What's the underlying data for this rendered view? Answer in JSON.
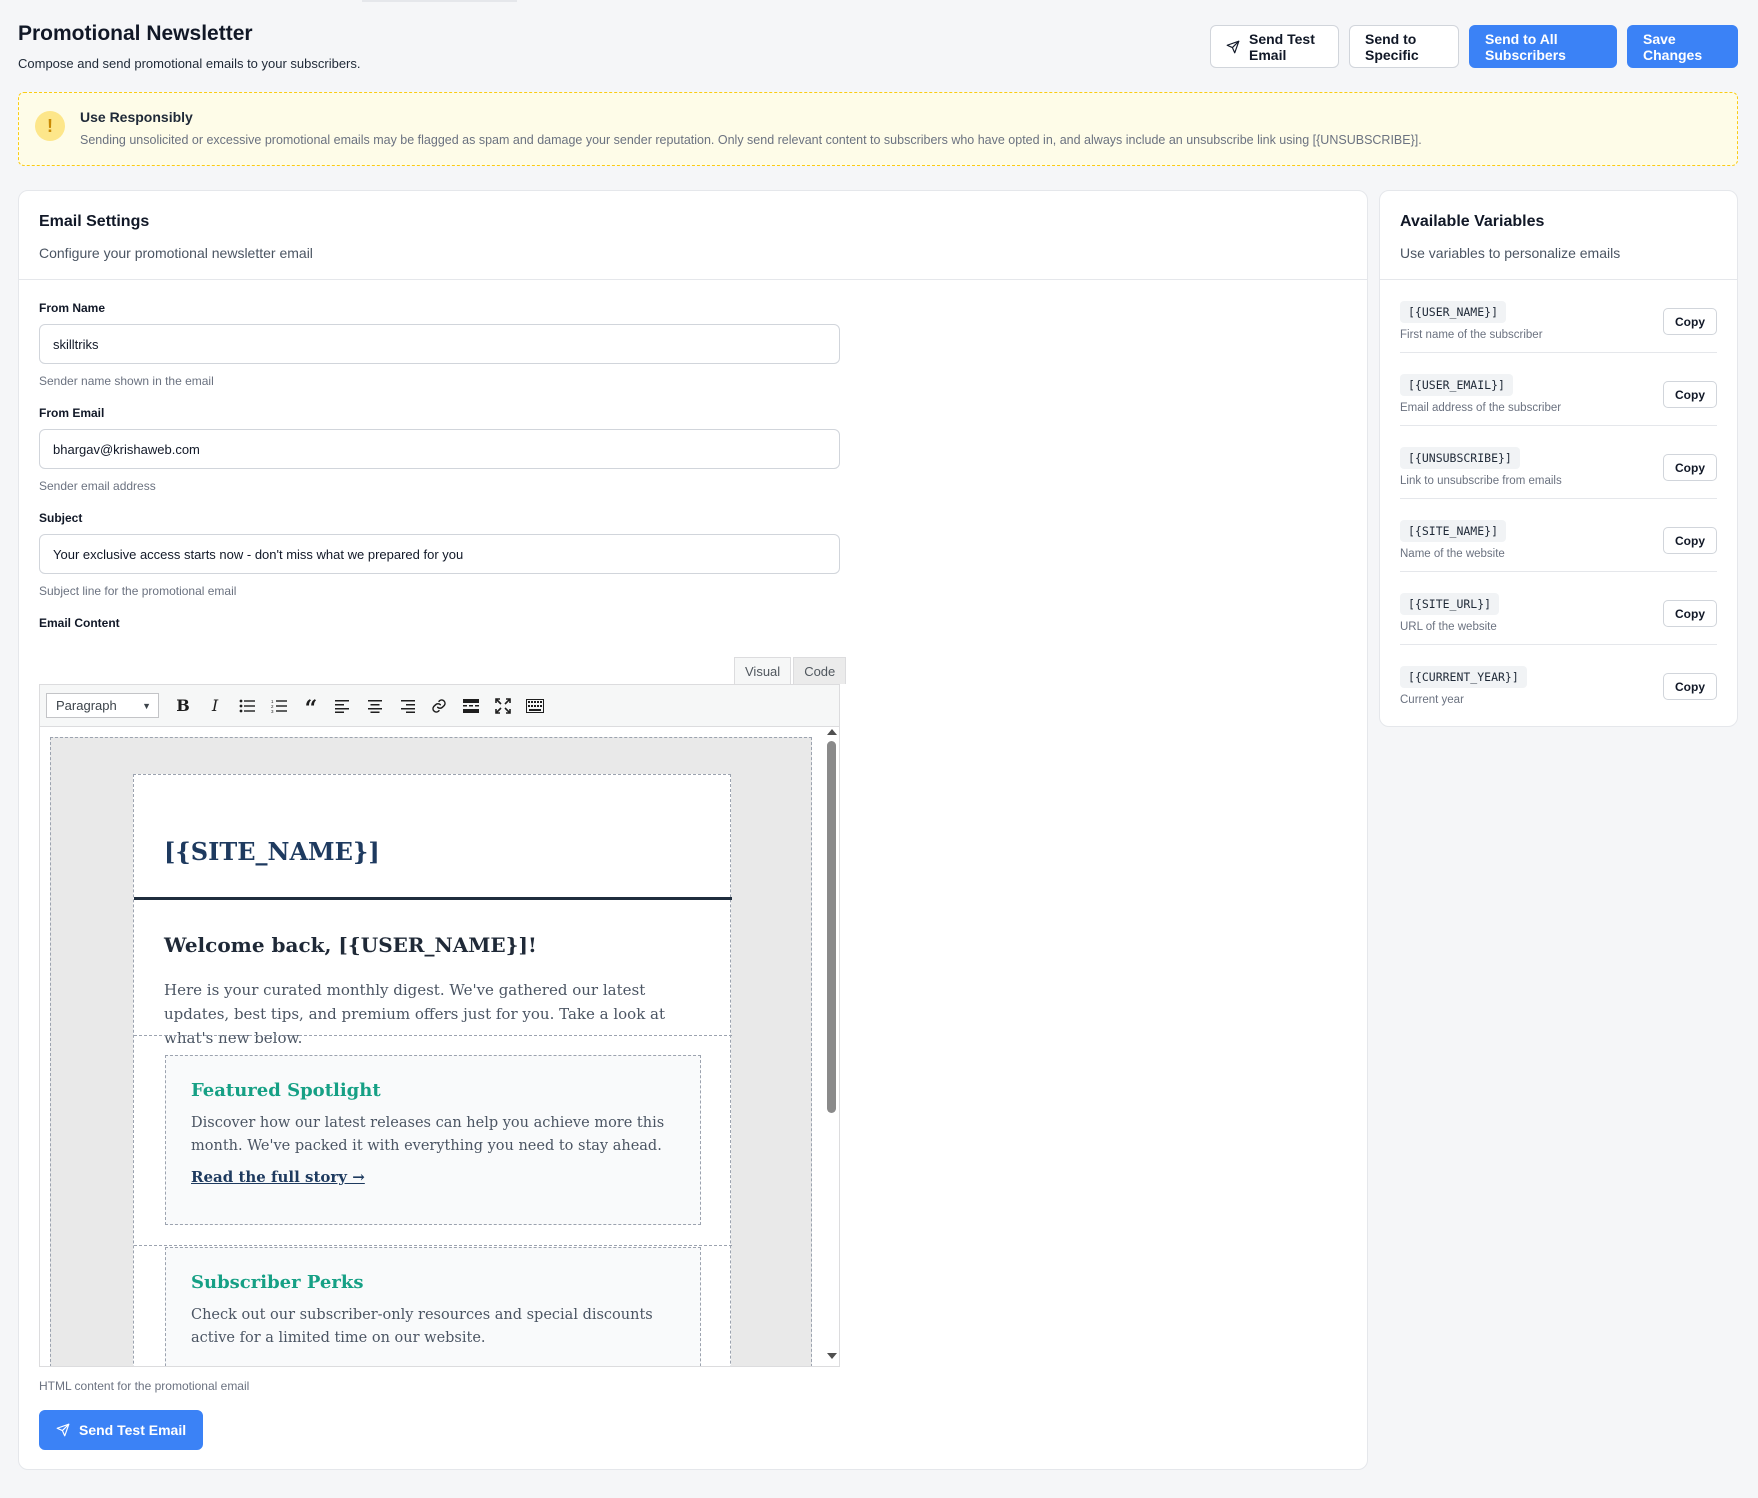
{
  "header": {
    "title": "Promotional Newsletter",
    "subtitle": "Compose and send promotional emails to your subscribers.",
    "buttons": {
      "send_test": "Send Test Email",
      "send_specific": "Send to Specific",
      "send_all": "Send to All Subscribers",
      "save": "Save Changes"
    }
  },
  "alert": {
    "icon": "warning-icon",
    "title": "Use Responsibly",
    "text": "Sending unsolicited or excessive promotional emails may be flagged as spam and damage your sender reputation. Only send relevant content to subscribers who have opted in, and always include an unsubscribe link using [{UNSUBSCRIBE}]."
  },
  "settings": {
    "title": "Email Settings",
    "description": "Configure your promotional newsletter email",
    "from_name": {
      "label": "From Name",
      "value": "skilltriks",
      "help": "Sender name shown in the email"
    },
    "from_email": {
      "label": "From Email",
      "value": "bhargav@krishaweb.com",
      "help": "Sender email address"
    },
    "subject": {
      "label": "Subject",
      "value": "Your exclusive access starts now - don't miss what we prepared for you",
      "help": "Subject line for the promotional email"
    },
    "content": {
      "label": "Email Content",
      "tabs": [
        "Visual",
        "Code"
      ],
      "active_tab": "Visual",
      "format": "Paragraph",
      "toolbar": [
        "bold-icon",
        "italic-icon",
        "bullet-list-icon",
        "numbered-list-icon",
        "blockquote-icon",
        "align-left-icon",
        "align-center-icon",
        "align-right-icon",
        "link-icon",
        "read-more-icon",
        "fullscreen-icon",
        "toolbar-toggle-icon"
      ],
      "help": "HTML content for the promotional email"
    },
    "send_test_label": "Send Test Email"
  },
  "email_preview": {
    "site_name": "[{SITE_NAME}]",
    "welcome": "Welcome back, [{USER_NAME}]!",
    "intro": "Here is your curated monthly digest. We've gathered our latest updates, best tips, and premium offers just for you. Take a look at what's new below.",
    "featured_title": "Featured Spotlight",
    "featured_text": "Discover how our latest releases can help you achieve more this month. We've packed it with everything you need to stay ahead.",
    "featured_link": "Read the full story →",
    "perks_title": "Subscriber Perks",
    "perks_text": "Check out our subscriber-only resources and special discounts active for a limited time on our website."
  },
  "variables": {
    "title": "Available Variables",
    "description": "Use variables to personalize emails",
    "copy_label": "Copy",
    "items": [
      {
        "code": "[{USER_NAME}]",
        "desc": "First name of the subscriber"
      },
      {
        "code": "[{USER_EMAIL}]",
        "desc": "Email address of the subscriber"
      },
      {
        "code": "[{UNSUBSCRIBE}]",
        "desc": "Link to unsubscribe from emails"
      },
      {
        "code": "[{SITE_NAME}]",
        "desc": "Name of the website"
      },
      {
        "code": "[{SITE_URL}]",
        "desc": "URL of the website"
      },
      {
        "code": "[{CURRENT_YEAR}]",
        "desc": "Current year"
      }
    ]
  },
  "colors": {
    "primary": "#3b82f6",
    "warning_bg": "#fefce8",
    "warning_border": "#facc15",
    "accent_green": "#16a085",
    "heading_navy": "#1e3a5f"
  }
}
